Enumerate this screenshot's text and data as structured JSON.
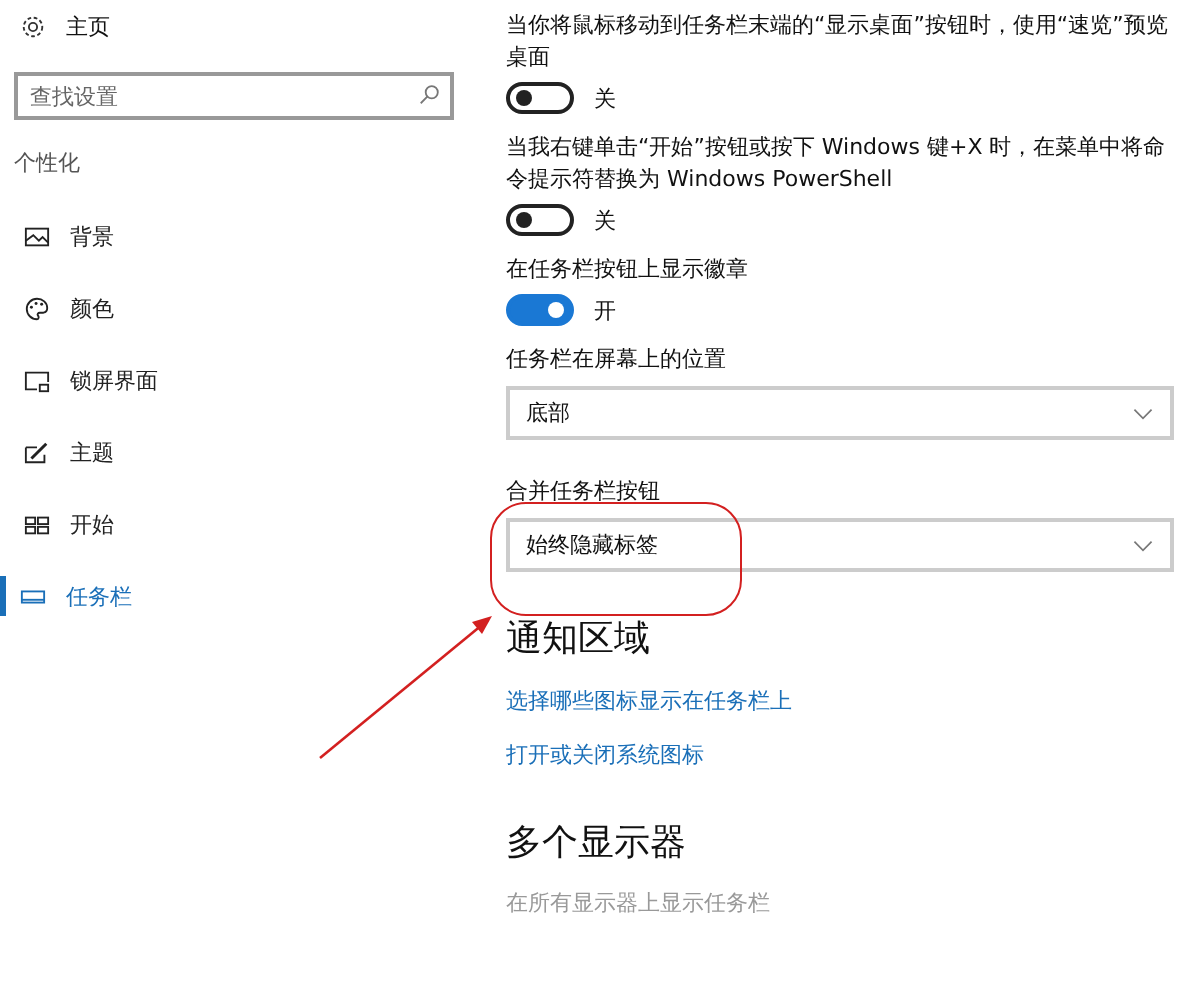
{
  "sidebar": {
    "home": {
      "label": "主页"
    },
    "search": {
      "placeholder": "查找设置"
    },
    "section": "个性化",
    "items": [
      {
        "label": "背景",
        "selected": false
      },
      {
        "label": "颜色",
        "selected": false
      },
      {
        "label": "锁屏界面",
        "selected": false
      },
      {
        "label": "主题",
        "selected": false
      },
      {
        "label": "开始",
        "selected": false
      },
      {
        "label": "任务栏",
        "selected": true
      }
    ]
  },
  "settings": [
    {
      "kind": "toggle",
      "label": "当你将鼠标移动到任务栏末端的“显示桌面”按钮时，使用“速览”预览桌面",
      "on": false,
      "state_text": "关"
    },
    {
      "kind": "toggle",
      "label": "当我右键单击“开始”按钮或按下 Windows 键+X 时，在菜单中将命令提示符替换为 Windows PowerShell",
      "on": false,
      "state_text": "关"
    },
    {
      "kind": "toggle",
      "label": "在任务栏按钮上显示徽章",
      "on": true,
      "state_text": "开"
    },
    {
      "kind": "dropdown",
      "label": "任务栏在屏幕上的位置",
      "value": "底部"
    },
    {
      "kind": "dropdown",
      "label": "合并任务栏按钮",
      "value": "始终隐藏标签"
    }
  ],
  "notification_area": {
    "heading": "通知区域",
    "links": [
      "选择哪些图标显示在任务栏上",
      "打开或关闭系统图标"
    ]
  },
  "multiple_displays": {
    "heading": "多个显示器",
    "option": {
      "label": "在所有显示器上显示任务栏",
      "disabled": true
    }
  }
}
